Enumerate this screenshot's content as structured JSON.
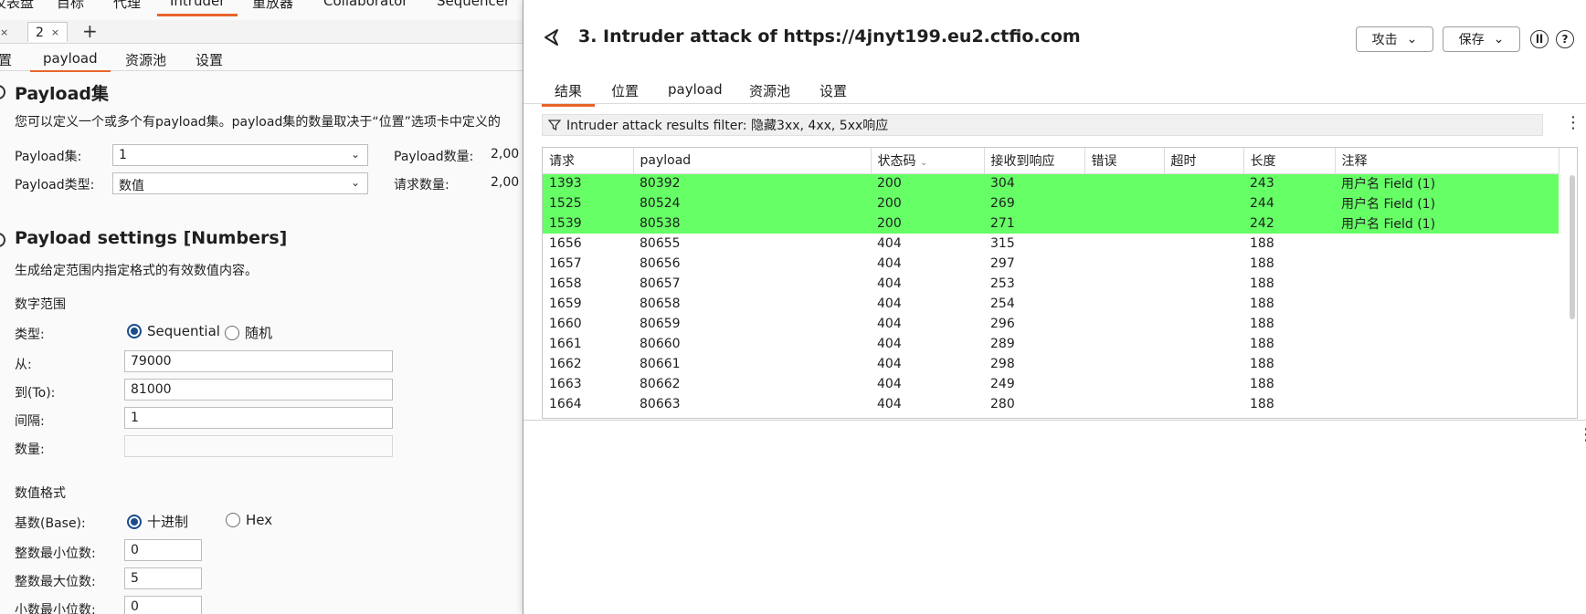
{
  "main_window": {
    "top_nav": [
      "仪表盘",
      "目标",
      "代理",
      "Intruder",
      "重放器",
      "Collaborator",
      "Sequencer"
    ],
    "active_top_nav": "Intruder",
    "attack_tabs": {
      "prev_close": "×",
      "current": "2",
      "current_close": "×",
      "add": "+"
    },
    "config_tabs": [
      "置",
      "payload",
      "资源池",
      "设置"
    ],
    "payload_sets": {
      "title": "Payload集",
      "description": "您可以定义一个或多个有payload集。payload集的数量取决于“位置”选项卡中定义的",
      "set_label": "Payload集:",
      "set_value": "1",
      "type_label": "Payload类型:",
      "type_value": "数值",
      "count_label": "Payload数量:",
      "count_value": "2,00",
      "requests_label": "请求数量:",
      "requests_value": "2,00"
    },
    "payload_settings": {
      "title": "Payload settings [Numbers]",
      "description": "生成给定范围内指定格式的有效数值内容。",
      "range_heading": "数字范围",
      "type_label": "类型:",
      "sequential_label": "Sequential",
      "random_label": "随机",
      "from_label": "从:",
      "from_value": "79000",
      "to_label": "到(To):",
      "to_value": "81000",
      "step_label": "间隔:",
      "step_value": "1",
      "howmany_label": "数量:",
      "howmany_value": "",
      "format_heading": "数值格式",
      "base_label": "基数(Base):",
      "decimal_label": "十进制",
      "hex_label": "Hex",
      "min_int_label": "整数最小位数:",
      "min_int_value": "0",
      "max_int_label": "整数最大位数:",
      "max_int_value": "5",
      "min_frac_label": "小数最小位数:",
      "min_frac_value": "0"
    }
  },
  "attack_window": {
    "title": "3. Intruder attack of https://4jnyt199.eu2.ctfio.com",
    "attack_button": "攻击",
    "save_button": "保存",
    "pause_icon": "pause-icon",
    "help_icon": "help-icon",
    "tabs": [
      "结果",
      "位置",
      "payload",
      "资源池",
      "设置"
    ],
    "active_tab": "结果",
    "filter_text": "Intruder attack results filter: 隐藏3xx, 4xx, 5xx响应",
    "columns": [
      "请求",
      "payload",
      "状态码",
      "接收到响应",
      "错误",
      "超时",
      "长度",
      "注释"
    ],
    "rows": [
      {
        "req": "1393",
        "payload": "80392",
        "status": "200",
        "recv": "304",
        "error": "",
        "timeout": "",
        "length": "243",
        "comment": "用户名 Field (1)",
        "highlight": true
      },
      {
        "req": "1525",
        "payload": "80524",
        "status": "200",
        "recv": "269",
        "error": "",
        "timeout": "",
        "length": "244",
        "comment": "用户名 Field (1)",
        "highlight": true
      },
      {
        "req": "1539",
        "payload": "80538",
        "status": "200",
        "recv": "271",
        "error": "",
        "timeout": "",
        "length": "242",
        "comment": "用户名 Field (1)",
        "highlight": true
      },
      {
        "req": "1656",
        "payload": "80655",
        "status": "404",
        "recv": "315",
        "error": "",
        "timeout": "",
        "length": "188",
        "comment": "",
        "highlight": false
      },
      {
        "req": "1657",
        "payload": "80656",
        "status": "404",
        "recv": "297",
        "error": "",
        "timeout": "",
        "length": "188",
        "comment": "",
        "highlight": false
      },
      {
        "req": "1658",
        "payload": "80657",
        "status": "404",
        "recv": "253",
        "error": "",
        "timeout": "",
        "length": "188",
        "comment": "",
        "highlight": false
      },
      {
        "req": "1659",
        "payload": "80658",
        "status": "404",
        "recv": "254",
        "error": "",
        "timeout": "",
        "length": "188",
        "comment": "",
        "highlight": false
      },
      {
        "req": "1660",
        "payload": "80659",
        "status": "404",
        "recv": "296",
        "error": "",
        "timeout": "",
        "length": "188",
        "comment": "",
        "highlight": false
      },
      {
        "req": "1661",
        "payload": "80660",
        "status": "404",
        "recv": "289",
        "error": "",
        "timeout": "",
        "length": "188",
        "comment": "",
        "highlight": false
      },
      {
        "req": "1662",
        "payload": "80661",
        "status": "404",
        "recv": "298",
        "error": "",
        "timeout": "",
        "length": "188",
        "comment": "",
        "highlight": false
      },
      {
        "req": "1663",
        "payload": "80662",
        "status": "404",
        "recv": "249",
        "error": "",
        "timeout": "",
        "length": "188",
        "comment": "",
        "highlight": false
      },
      {
        "req": "1664",
        "payload": "80663",
        "status": "404",
        "recv": "280",
        "error": "",
        "timeout": "",
        "length": "188",
        "comment": "",
        "highlight": false
      }
    ],
    "highlight_color": "#66ff66",
    "accent_color": "#e8642b"
  }
}
